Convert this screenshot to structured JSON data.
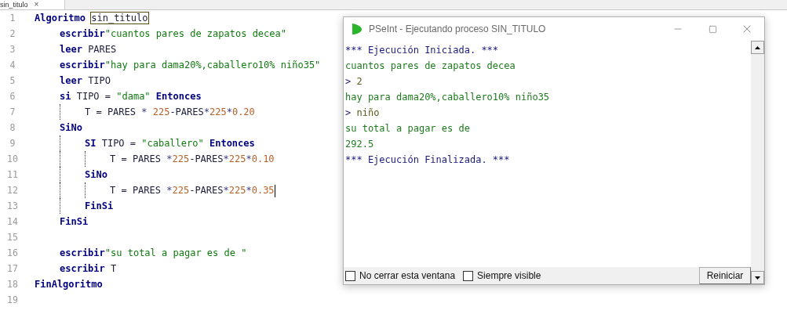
{
  "editor": {
    "tab": {
      "label": "sin_titulo",
      "close": "×"
    },
    "lines": [
      {
        "number": "1",
        "tokens": [
          {
            "kind": "kw",
            "text": "Algoritmo "
          },
          {
            "kind": "boxed",
            "text": "sin_titulo"
          }
        ],
        "guide": false,
        "children": [
          {
            "number": "2",
            "tokens": [
              {
                "kind": "kw",
                "text": "escribir"
              },
              {
                "kind": "str",
                "text": "\"cuantos pares de zapatos decea\""
              }
            ]
          },
          {
            "number": "3",
            "tokens": [
              {
                "kind": "kw",
                "text": "leer"
              },
              {
                "kind": "id",
                "text": " PARES"
              }
            ]
          },
          {
            "number": "4",
            "tokens": [
              {
                "kind": "kw",
                "text": "escribir"
              },
              {
                "kind": "str",
                "text": "\"hay para dama20%,caballero10% niño35\""
              }
            ]
          },
          {
            "number": "5",
            "tokens": [
              {
                "kind": "kw",
                "text": "leer"
              },
              {
                "kind": "id",
                "text": " TIPO"
              }
            ]
          },
          {
            "number": "6",
            "tokens": [
              {
                "kind": "kw",
                "text": "si"
              },
              {
                "kind": "id",
                "text": " TIPO = "
              },
              {
                "kind": "str",
                "text": "\"dama\""
              },
              {
                "kind": "kw",
                "text": " Entonces"
              }
            ],
            "guide": true,
            "children": [
              {
                "number": "7",
                "tokens": [
                  {
                    "kind": "id",
                    "text": "T = PARES "
                  },
                  {
                    "kind": "op",
                    "text": "*"
                  },
                  {
                    "kind": "num",
                    "text": " 225"
                  },
                  {
                    "kind": "id",
                    "text": "-PARES"
                  },
                  {
                    "kind": "op",
                    "text": "*"
                  },
                  {
                    "kind": "num",
                    "text": "225"
                  },
                  {
                    "kind": "op",
                    "text": "*"
                  },
                  {
                    "kind": "num",
                    "text": "0.20"
                  }
                ]
              }
            ]
          },
          {
            "number": "8",
            "tokens": [
              {
                "kind": "kw",
                "text": "SiNo"
              }
            ],
            "guide": true,
            "children": [
              {
                "number": "9",
                "tokens": [
                  {
                    "kind": "kw",
                    "text": "SI"
                  },
                  {
                    "kind": "id",
                    "text": " TIPO = "
                  },
                  {
                    "kind": "str",
                    "text": "\"caballero\""
                  },
                  {
                    "kind": "kw",
                    "text": " Entonces"
                  }
                ],
                "guide": true,
                "children": [
                  {
                    "number": "10",
                    "tokens": [
                      {
                        "kind": "id",
                        "text": "T = PARES "
                      },
                      {
                        "kind": "op",
                        "text": "*"
                      },
                      {
                        "kind": "num",
                        "text": "225"
                      },
                      {
                        "kind": "id",
                        "text": "-PARES"
                      },
                      {
                        "kind": "op",
                        "text": "*"
                      },
                      {
                        "kind": "num",
                        "text": "225"
                      },
                      {
                        "kind": "op",
                        "text": "*"
                      },
                      {
                        "kind": "num",
                        "text": "0.10"
                      }
                    ]
                  }
                ]
              },
              {
                "number": "11",
                "tokens": [
                  {
                    "kind": "kw",
                    "text": "SiNo"
                  }
                ],
                "guide": true,
                "children": [
                  {
                    "number": "12",
                    "tokens": [
                      {
                        "kind": "id",
                        "text": "T = PARES "
                      },
                      {
                        "kind": "op",
                        "text": "*"
                      },
                      {
                        "kind": "num",
                        "text": "225"
                      },
                      {
                        "kind": "id",
                        "text": "-PARES"
                      },
                      {
                        "kind": "op",
                        "text": "*"
                      },
                      {
                        "kind": "num",
                        "text": "225"
                      },
                      {
                        "kind": "op",
                        "text": "*"
                      },
                      {
                        "kind": "num",
                        "text": "0.35"
                      }
                    ],
                    "cursor": true
                  }
                ]
              },
              {
                "number": "13",
                "tokens": [
                  {
                    "kind": "kw",
                    "text": "FinSi"
                  }
                ]
              }
            ]
          },
          {
            "number": "14",
            "tokens": [
              {
                "kind": "kw",
                "text": "FinSi"
              }
            ]
          },
          {
            "number": "15"
          },
          {
            "number": "16",
            "tokens": [
              {
                "kind": "kw",
                "text": "escribir"
              },
              {
                "kind": "str",
                "text": "\"su total a pagar es de \""
              }
            ]
          },
          {
            "number": "17",
            "tokens": [
              {
                "kind": "kw",
                "text": "escribir"
              },
              {
                "kind": "id",
                "text": " T"
              }
            ]
          }
        ]
      },
      {
        "number": "18",
        "tokens": [
          {
            "kind": "kw",
            "text": "FinAlgoritmo"
          }
        ]
      },
      {
        "number": "19"
      }
    ]
  },
  "run_window": {
    "title": "PSeInt - Ejecutando proceso SIN_TITULO",
    "console": [
      {
        "kind": "system",
        "text": "*** Ejecución Iniciada. ***"
      },
      {
        "kind": "output",
        "text": "cuantos pares de zapatos decea"
      },
      {
        "kind": "input",
        "prompt": ">",
        "text": "2"
      },
      {
        "kind": "output",
        "text": "hay para dama20%,caballero10% niño35"
      },
      {
        "kind": "input",
        "prompt": ">",
        "text": "niño"
      },
      {
        "kind": "output",
        "text": "su total a pagar es de"
      },
      {
        "kind": "output",
        "text": "292.5"
      },
      {
        "kind": "system",
        "text": "*** Ejecución Finalizada. ***"
      }
    ],
    "options": [
      {
        "label": "No cerrar esta ventana",
        "checked": false
      },
      {
        "label": "Siempre visible",
        "checked": false
      }
    ],
    "buttons": [
      "Reiniciar"
    ]
  }
}
